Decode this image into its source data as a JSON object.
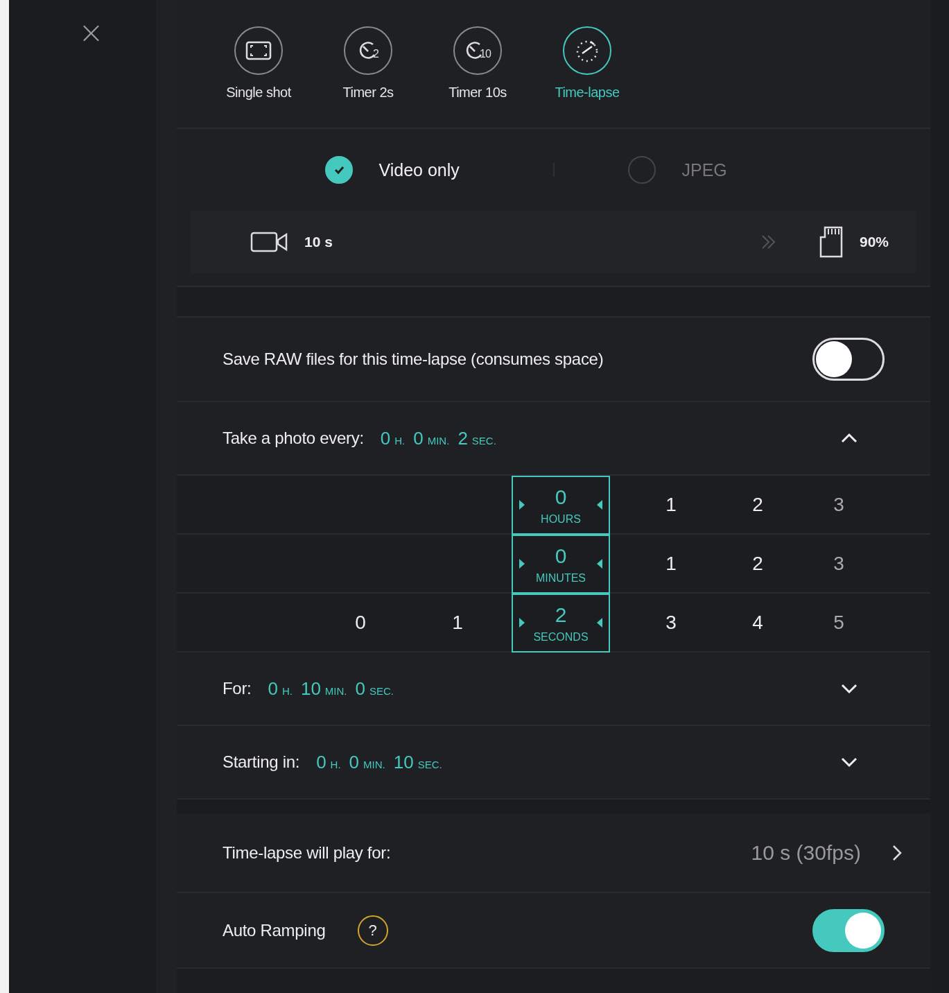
{
  "close_button": {
    "label": "×"
  },
  "modes": [
    {
      "kind": "frame",
      "label": "Single shot",
      "selected": false
    },
    {
      "kind": "timer",
      "badge": "2",
      "label": "Timer 2s",
      "selected": false
    },
    {
      "kind": "timer",
      "badge": "10",
      "label": "Timer 10s",
      "selected": false
    },
    {
      "kind": "timelapse",
      "label": "Time-lapse",
      "selected": true
    }
  ],
  "formats": [
    {
      "label": "Video only",
      "checked": true
    },
    {
      "label": "JPEG",
      "checked": false
    }
  ],
  "info_bar": {
    "duration": "10 s",
    "storage": "90%"
  },
  "raw_files": {
    "label": "Save RAW files for this time-lapse (consumes space)",
    "on": false
  },
  "timings": [
    {
      "label": "Take a photo every:",
      "values": [
        {
          "number": "0",
          "unit": "H."
        },
        {
          "number": "0",
          "unit": "MIN."
        },
        {
          "number": "2",
          "unit": "SEC."
        }
      ],
      "expanded": true,
      "pickers": [
        {
          "unit": "HOURS",
          "items": [
            {
              "value": "0",
              "selected": true
            },
            {
              "value": "1",
              "selected": false
            },
            {
              "value": "2",
              "selected": false
            },
            {
              "value": "3",
              "selected": false
            }
          ]
        },
        {
          "unit": "MINUTES",
          "items": [
            {
              "value": "0",
              "selected": true
            },
            {
              "value": "1",
              "selected": false
            },
            {
              "value": "2",
              "selected": false
            },
            {
              "value": "3",
              "selected": false
            }
          ]
        },
        {
          "unit": "SECONDS",
          "items": [
            {
              "value": "0",
              "selected": false
            },
            {
              "value": "1",
              "selected": false
            },
            {
              "value": "2",
              "selected": true
            },
            {
              "value": "3",
              "selected": false
            },
            {
              "value": "4",
              "selected": false
            },
            {
              "value": "5",
              "selected": false
            }
          ]
        }
      ]
    },
    {
      "label": "For:",
      "values": [
        {
          "number": "0",
          "unit": "H."
        },
        {
          "number": "10",
          "unit": "MIN."
        },
        {
          "number": "0",
          "unit": "SEC."
        }
      ],
      "expanded": false
    },
    {
      "label": "Starting in:",
      "values": [
        {
          "number": "0",
          "unit": "H."
        },
        {
          "number": "0",
          "unit": "MIN."
        },
        {
          "number": "10",
          "unit": "SEC."
        }
      ],
      "expanded": false
    }
  ],
  "play_for": {
    "label": "Time-lapse will play for:",
    "value": "10 s (30fps)"
  },
  "auto_ramping": {
    "label": "Auto Ramping",
    "help": "?",
    "on": true
  }
}
